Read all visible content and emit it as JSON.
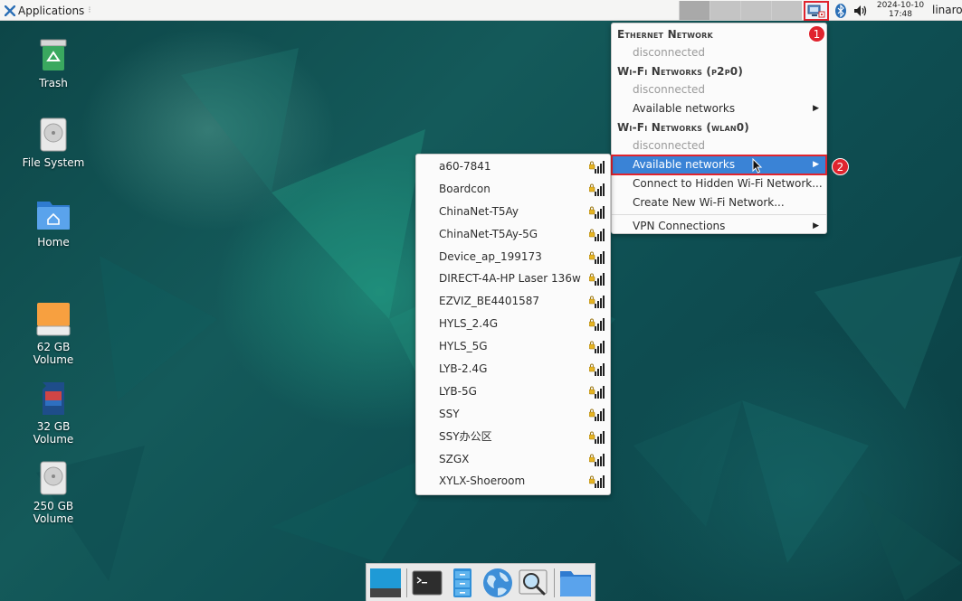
{
  "panel": {
    "applications_label": "Applications",
    "clock_date": "2024-10-10",
    "clock_time": "17:48",
    "user": "linaro"
  },
  "desktop_icons": [
    {
      "label": "Trash",
      "icon": "trash-icon"
    },
    {
      "label": "File System",
      "icon": "drive-icon"
    },
    {
      "label": "Home",
      "icon": "home-folder-icon"
    },
    {
      "label": "62 GB\nVolume",
      "icon": "removable-drive-icon"
    },
    {
      "label": "32 GB\nVolume",
      "icon": "sd-card-icon"
    },
    {
      "label": "250 GB\nVolume",
      "icon": "drive-icon"
    }
  ],
  "network_menu": {
    "ethernet_header": "Ethernet Network",
    "ethernet_status": "disconnected",
    "wifi_p2p_header": "Wi-Fi Networks (p2p0)",
    "wifi_p2p_status": "disconnected",
    "wifi_p2p_available": "Available networks",
    "wifi_wlan_header": "Wi-Fi Networks (wlan0)",
    "wifi_wlan_status": "disconnected",
    "wifi_wlan_available": "Available networks",
    "connect_hidden": "Connect to Hidden Wi-Fi Network...",
    "create_new": "Create New Wi-Fi Network...",
    "vpn": "VPN Connections"
  },
  "available_networks": [
    "a60-7841",
    "Boardcon",
    "ChinaNet-T5Ay",
    "ChinaNet-T5Ay-5G",
    "Device_ap_199173",
    "DIRECT-4A-HP Laser 136w",
    "EZVIZ_BE4401587",
    "HYLS_2.4G",
    "HYLS_5G",
    "LYB-2.4G",
    "LYB-5G",
    "SSY",
    "SSY办公区",
    "SZGX",
    "XYLX-Shoeroom"
  ],
  "callouts": [
    "1",
    "2"
  ],
  "dock_items": [
    "show-desktop-icon",
    "terminal-icon",
    "file-cabinet-icon",
    "web-browser-icon",
    "search-icon",
    "folder-icon"
  ],
  "colors": {
    "highlight": "#3a83d6",
    "callout": "#e0242e"
  }
}
